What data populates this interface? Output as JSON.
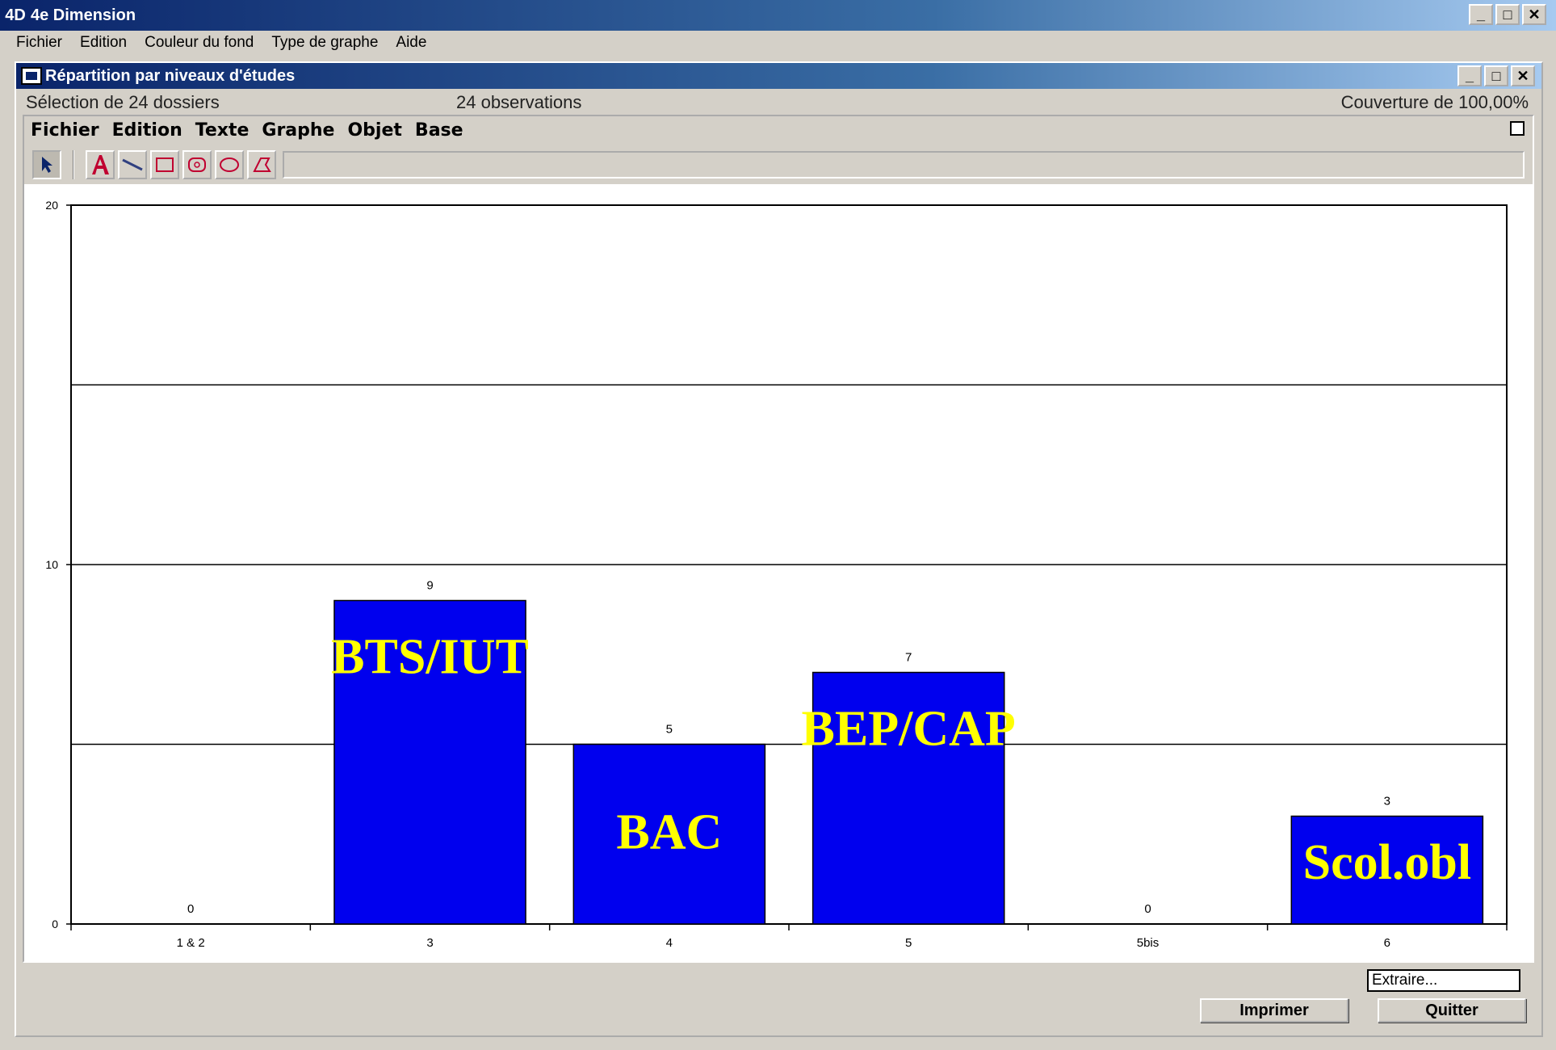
{
  "app": {
    "logo": "4D",
    "title": "4e Dimension",
    "menu": [
      "Fichier",
      "Edition",
      "Couleur du fond",
      "Type de graphe",
      "Aide"
    ]
  },
  "window_controls": {
    "minimize": "_",
    "maximize": "□",
    "close": "✕"
  },
  "doc": {
    "title": "Répartition par niveaux d'études",
    "status": {
      "selection": "Sélection de 24 dossiers",
      "observations": "24 observations",
      "coverage": "Couverture de 100,00%"
    }
  },
  "graph": {
    "menu": [
      "Fichier",
      "Edition",
      "Texte",
      "Graphe",
      "Objet",
      "Base"
    ],
    "tools": [
      "arrow-tool",
      "text-tool",
      "line-tool",
      "rect-tool",
      "rounded-rect-tool",
      "oval-tool",
      "polygon-tool"
    ]
  },
  "chart_data": {
    "type": "bar",
    "categories": [
      "1 & 2",
      "3",
      "4",
      "5",
      "5bis",
      "6"
    ],
    "values": [
      0,
      9,
      5,
      7,
      0,
      3
    ],
    "data_labels": [
      "0",
      "9",
      "5",
      "7",
      "0",
      "3"
    ],
    "overlay_labels": [
      "",
      "BTS/IUT",
      "BAC",
      "BEP/CAP",
      "",
      "Scol.obl"
    ],
    "y_ticks": [
      0,
      10,
      20
    ],
    "ylim": [
      0,
      20
    ],
    "grid": true,
    "bar_color": "#0000ee",
    "label_color": "#ffff00"
  },
  "footer": {
    "extract_placeholder": "Extraire...",
    "print_label": "Imprimer",
    "quit_label": "Quitter"
  }
}
